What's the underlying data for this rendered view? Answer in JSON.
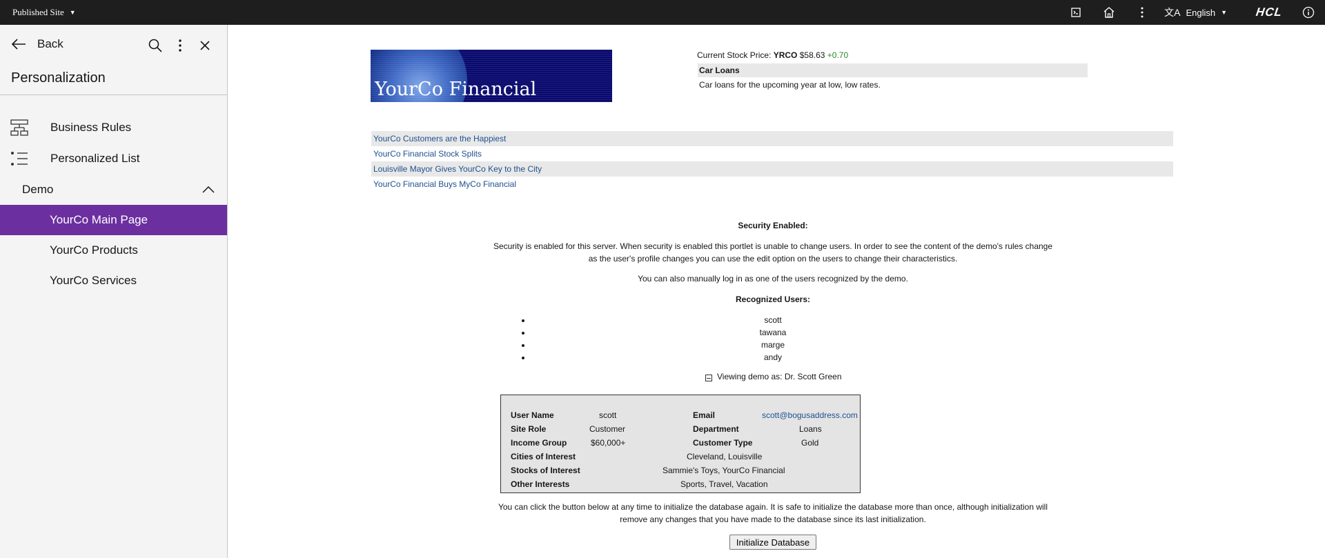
{
  "topbar": {
    "site_label": "Published Site",
    "language": "English",
    "brand": "HCL",
    "icons": [
      "site-preview-icon",
      "home-icon",
      "overflow-menu-icon",
      "translate-icon",
      "info-icon"
    ]
  },
  "sidebar": {
    "back_label": "Back",
    "title": "Personalization",
    "items": [
      {
        "label": "Business Rules",
        "icon": "business-rules-icon"
      },
      {
        "label": "Personalized List",
        "icon": "list-icon"
      }
    ],
    "group": {
      "label": "Demo",
      "expanded": true
    },
    "sub_items": [
      {
        "label": "YourCo Main Page",
        "active": true
      },
      {
        "label": "YourCo Products",
        "active": false
      },
      {
        "label": "YourCo Services",
        "active": false
      }
    ],
    "accent_color": "#6c2fa0"
  },
  "content": {
    "logo_text": "YourCo Financial",
    "stock": {
      "prefix": "Current Stock Price:",
      "symbol": "YRCO",
      "price": "$58.63",
      "change": "+0.70"
    },
    "promo": {
      "title": "Car Loans",
      "text": "Car loans for the upcoming year at low, low rates."
    },
    "news": [
      "YourCo Customers are the Happiest",
      "YourCo Financial Stock Splits",
      "Louisville Mayor Gives YourCo Key to the City",
      "YourCo Financial Buys MyCo Financial"
    ],
    "security_title": "Security Enabled:",
    "security_text": "Security is enabled for this server. When security is enabled this portlet is unable to change users. In order to see the content of the demo's rules change as the user's profile changes you can use the edit option on the users to change their characteristics.",
    "security_also": "You can also manually log in as one of the users recognized by the demo.",
    "recognized_title": "Recognized Users:",
    "users": [
      "scott",
      "tawana",
      "marge",
      "andy"
    ],
    "viewing": "Viewing demo as: Dr. Scott Green",
    "profile": {
      "user_name_label": "User Name",
      "user_name": "scott",
      "email_label": "Email",
      "email": "scott@bogusaddress.com",
      "site_role_label": "Site Role",
      "site_role": "Customer",
      "department_label": "Department",
      "department": "Loans",
      "income_label": "Income Group",
      "income": "$60,000+",
      "customer_type_label": "Customer Type",
      "customer_type": "Gold",
      "cities_label": "Cities of Interest",
      "cities": "Cleveland, Louisville",
      "stocks_label": "Stocks of Interest",
      "stocks": "Sammie's Toys, YourCo Financial",
      "other_label": "Other Interests",
      "other": "Sports, Travel, Vacation"
    },
    "init_text": "You can click the button below at any time to initialize the database again. It is safe to initialize the database more than once, although initialization will remove any changes that you have made to the database since its last initialization.",
    "init_button": "Initialize Database"
  }
}
